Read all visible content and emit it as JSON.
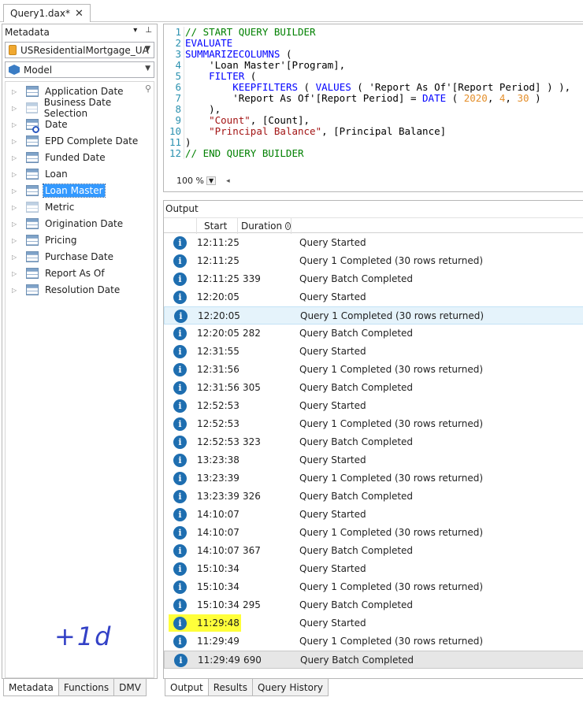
{
  "doc_tab": {
    "title": "Query1.dax*",
    "close": "✕"
  },
  "metadata_pane": {
    "title": "Metadata",
    "dropdown_glyph": "▾",
    "pin_glyph": "⊥",
    "database": "USResidentialMortgage_UA",
    "model": "Model",
    "tables": [
      {
        "label": "Application Date",
        "icon": "table-icon"
      },
      {
        "label": "Business Date Selection",
        "icon": "table-icon-dim"
      },
      {
        "label": "Date",
        "icon": "date-table-icon"
      },
      {
        "label": "EPD Complete Date",
        "icon": "table-icon"
      },
      {
        "label": "Funded Date",
        "icon": "table-icon"
      },
      {
        "label": "Loan",
        "icon": "table-icon"
      },
      {
        "label": "Loan Master",
        "icon": "table-icon",
        "selected": true
      },
      {
        "label": "Metric",
        "icon": "table-icon-dim"
      },
      {
        "label": "Origination Date",
        "icon": "table-icon"
      },
      {
        "label": "Pricing",
        "icon": "table-icon"
      },
      {
        "label": "Purchase Date",
        "icon": "table-icon"
      },
      {
        "label": "Report As Of",
        "icon": "table-icon"
      },
      {
        "label": "Resolution Date",
        "icon": "table-icon"
      }
    ],
    "annotation": "+1d",
    "tabs": [
      "Metadata",
      "Functions",
      "DMV"
    ]
  },
  "editor": {
    "line_numbers": [
      "1",
      "2",
      "3",
      "4",
      "5",
      "6",
      "7",
      "8",
      "9",
      "10",
      "11",
      "12"
    ],
    "zoom": "100 %"
  },
  "output": {
    "title": "Output",
    "columns": {
      "start": "Start",
      "duration": "Duration"
    },
    "rows": [
      {
        "start": "12:11:25",
        "duration": "",
        "message": "Query Started"
      },
      {
        "start": "12:11:25",
        "duration": "",
        "message": "Query 1 Completed (30 rows returned)"
      },
      {
        "start": "12:11:25",
        "duration": "339",
        "message": "Query Batch Completed"
      },
      {
        "start": "12:20:05",
        "duration": "",
        "message": "Query Started"
      },
      {
        "start": "12:20:05",
        "duration": "",
        "message": "Query 1 Completed (30 rows returned)",
        "selected": true
      },
      {
        "start": "12:20:05",
        "duration": "282",
        "message": "Query Batch Completed"
      },
      {
        "start": "12:31:55",
        "duration": "",
        "message": "Query Started"
      },
      {
        "start": "12:31:56",
        "duration": "",
        "message": "Query 1 Completed (30 rows returned)"
      },
      {
        "start": "12:31:56",
        "duration": "305",
        "message": "Query Batch Completed"
      },
      {
        "start": "12:52:53",
        "duration": "",
        "message": "Query Started"
      },
      {
        "start": "12:52:53",
        "duration": "",
        "message": "Query 1 Completed (30 rows returned)"
      },
      {
        "start": "12:52:53",
        "duration": "323",
        "message": "Query Batch Completed"
      },
      {
        "start": "13:23:38",
        "duration": "",
        "message": "Query Started"
      },
      {
        "start": "13:23:39",
        "duration": "",
        "message": "Query 1 Completed (30 rows returned)"
      },
      {
        "start": "13:23:39",
        "duration": "326",
        "message": "Query Batch Completed"
      },
      {
        "start": "14:10:07",
        "duration": "",
        "message": "Query Started"
      },
      {
        "start": "14:10:07",
        "duration": "",
        "message": "Query 1 Completed (30 rows returned)"
      },
      {
        "start": "14:10:07",
        "duration": "367",
        "message": "Query Batch Completed"
      },
      {
        "start": "15:10:34",
        "duration": "",
        "message": "Query Started"
      },
      {
        "start": "15:10:34",
        "duration": "",
        "message": "Query 1 Completed (30 rows returned)"
      },
      {
        "start": "15:10:34",
        "duration": "295",
        "message": "Query Batch Completed"
      },
      {
        "start": "11:29:48",
        "duration": "",
        "message": "Query Started",
        "highlighted": true
      },
      {
        "start": "11:29:49",
        "duration": "",
        "message": "Query 1 Completed (30 rows returned)"
      },
      {
        "start": "11:29:49",
        "duration": "690",
        "message": "Query Batch Completed",
        "last": true
      }
    ],
    "tabs": [
      "Output",
      "Results",
      "Query History"
    ]
  },
  "colors": {
    "selection": "#3399ff",
    "info_icon": "#1e6eb0",
    "highlight": "#ffff3a",
    "annotation": "#3341c6"
  }
}
